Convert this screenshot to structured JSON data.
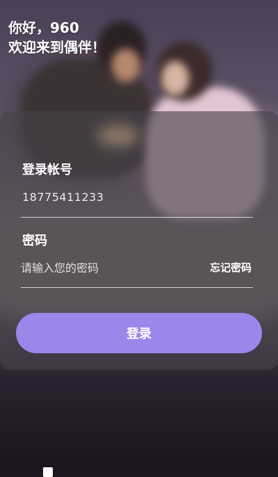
{
  "header": {
    "greeting_line1": "你好，960",
    "greeting_line2": "欢迎来到偶伴！"
  },
  "login_form": {
    "account_label": "登录帐号",
    "account_value": "18775411233",
    "password_label": "密码",
    "password_placeholder": "请输入您的密码",
    "forgot_password": "忘记密码",
    "login_button": "登录"
  },
  "colors": {
    "accent": "#9c86ea",
    "card": "#46424a"
  }
}
